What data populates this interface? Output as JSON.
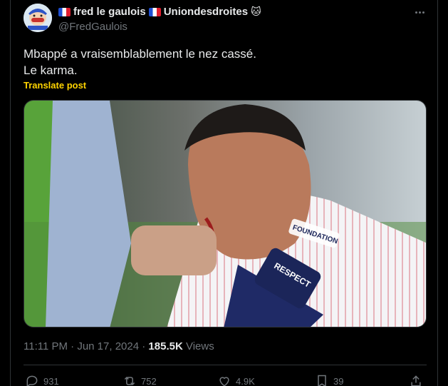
{
  "author": {
    "display_name": "fred le gaulois",
    "display_name_suffix": "Uniondesdroites",
    "emoji_after_name": "🐱",
    "handle": "@FredGaulois"
  },
  "post": {
    "text_line1": "Mbappé a vraisemblablement le nez cassé.",
    "text_line2": "Le karma.",
    "translate_label": "Translate post",
    "image_badges": {
      "armband": "RESPECT",
      "foundation": "FOUNDATION"
    }
  },
  "meta": {
    "time": "11:11 PM",
    "sep": "·",
    "date": "Jun 17, 2024",
    "views_count": "185.5K",
    "views_label": "Views"
  },
  "actions": {
    "replies": "931",
    "reposts": "752",
    "likes": "4.9K",
    "bookmarks": "39"
  },
  "colors": {
    "background": "#000000",
    "text": "#e7e9ea",
    "muted": "#71767b",
    "border": "#2f3336",
    "translate": "#ffd400"
  }
}
